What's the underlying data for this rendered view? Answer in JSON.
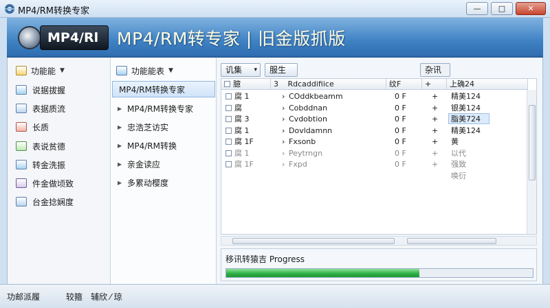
{
  "window": {
    "title": "MP4/RM转换专家",
    "buttons": {
      "minimize": "—",
      "maximize": "□",
      "close": "✕"
    }
  },
  "banner": {
    "logo_text": "MP4/Rl",
    "headline": "MP4/RM转专家 | 旧金版抓版"
  },
  "sidebar": {
    "header": "功能能",
    "items": [
      {
        "label": "说据拔握",
        "icon": "document-icon"
      },
      {
        "label": "表据质流",
        "icon": "table-icon"
      },
      {
        "label": "长质",
        "icon": "chart-icon"
      },
      {
        "label": "表说贫德",
        "icon": "graph-icon"
      },
      {
        "label": "转金洗振",
        "icon": "convert-icon"
      },
      {
        "label": "件金做顷致",
        "icon": "file-icon"
      },
      {
        "label": "台金捻娴度",
        "icon": "settings-icon"
      }
    ]
  },
  "nav": {
    "header": "功能能表",
    "items": [
      {
        "label": "MP4/RM转换专家",
        "selected": true
      },
      {
        "label": "MP4/RM转换专家",
        "selected": false
      },
      {
        "label": "忠浩芝访实",
        "selected": false
      },
      {
        "label": "MP4/RM转换",
        "selected": false
      },
      {
        "label": "亲金读应",
        "selected": false
      },
      {
        "label": "多累动樱度",
        "selected": false
      }
    ]
  },
  "toolbar": {
    "filter_label": "讥集",
    "filter_arrow": "▾",
    "button2": "服生",
    "button3": "杂讯"
  },
  "grid": {
    "columns": [
      "臆",
      "3",
      "Rdcaddifiice",
      "纹F",
      "+",
      "上确24"
    ],
    "rows": [
      {
        "c1": "腐 1",
        "c2": "›",
        "c3": "COddkbeamm",
        "c4": "0 F",
        "c5": "+",
        "c6": "精美124"
      },
      {
        "c1": "腐",
        "c2": "›",
        "c3": "Cobddnan",
        "c4": "0 F",
        "c5": "+",
        "c6": "银美124"
      },
      {
        "c1": "腐 3",
        "c2": "›",
        "c3": "Cvdobtion",
        "c4": "0 F",
        "c5": "+",
        "c6": "脂美724"
      },
      {
        "c1": "腐 1",
        "c2": "›",
        "c3": "Dovldamnn",
        "c4": "0 F",
        "c5": "+",
        "c6": "精美124"
      },
      {
        "c1": "腐 1F",
        "c2": "›",
        "c3": "Fxsonb",
        "c4": "0 F",
        "c5": "+",
        "c6": "黄"
      },
      {
        "c1": "腐 1",
        "c2": "›",
        "c3": "Peytrngn",
        "c4": "0 F",
        "c5": "+",
        "c6": "以代"
      },
      {
        "c1": "腐 1F",
        "c2": "›",
        "c3": "Fxpd",
        "c4": "0 F",
        "c5": "+",
        "c6": "强致"
      },
      {
        "c1": "",
        "c2": "",
        "c3": "",
        "c4": "",
        "c5": "",
        "c6": "唤衍"
      }
    ]
  },
  "progress": {
    "label": "移讯转猿吉 Progress",
    "value": 0.63
  },
  "statusbar": {
    "item1": "功邮派履",
    "item2": "较箍",
    "item3": "辅欣 ⁄ 琼"
  },
  "colors": {
    "accent": "#3f82c4",
    "progress": "#2fb24b"
  }
}
